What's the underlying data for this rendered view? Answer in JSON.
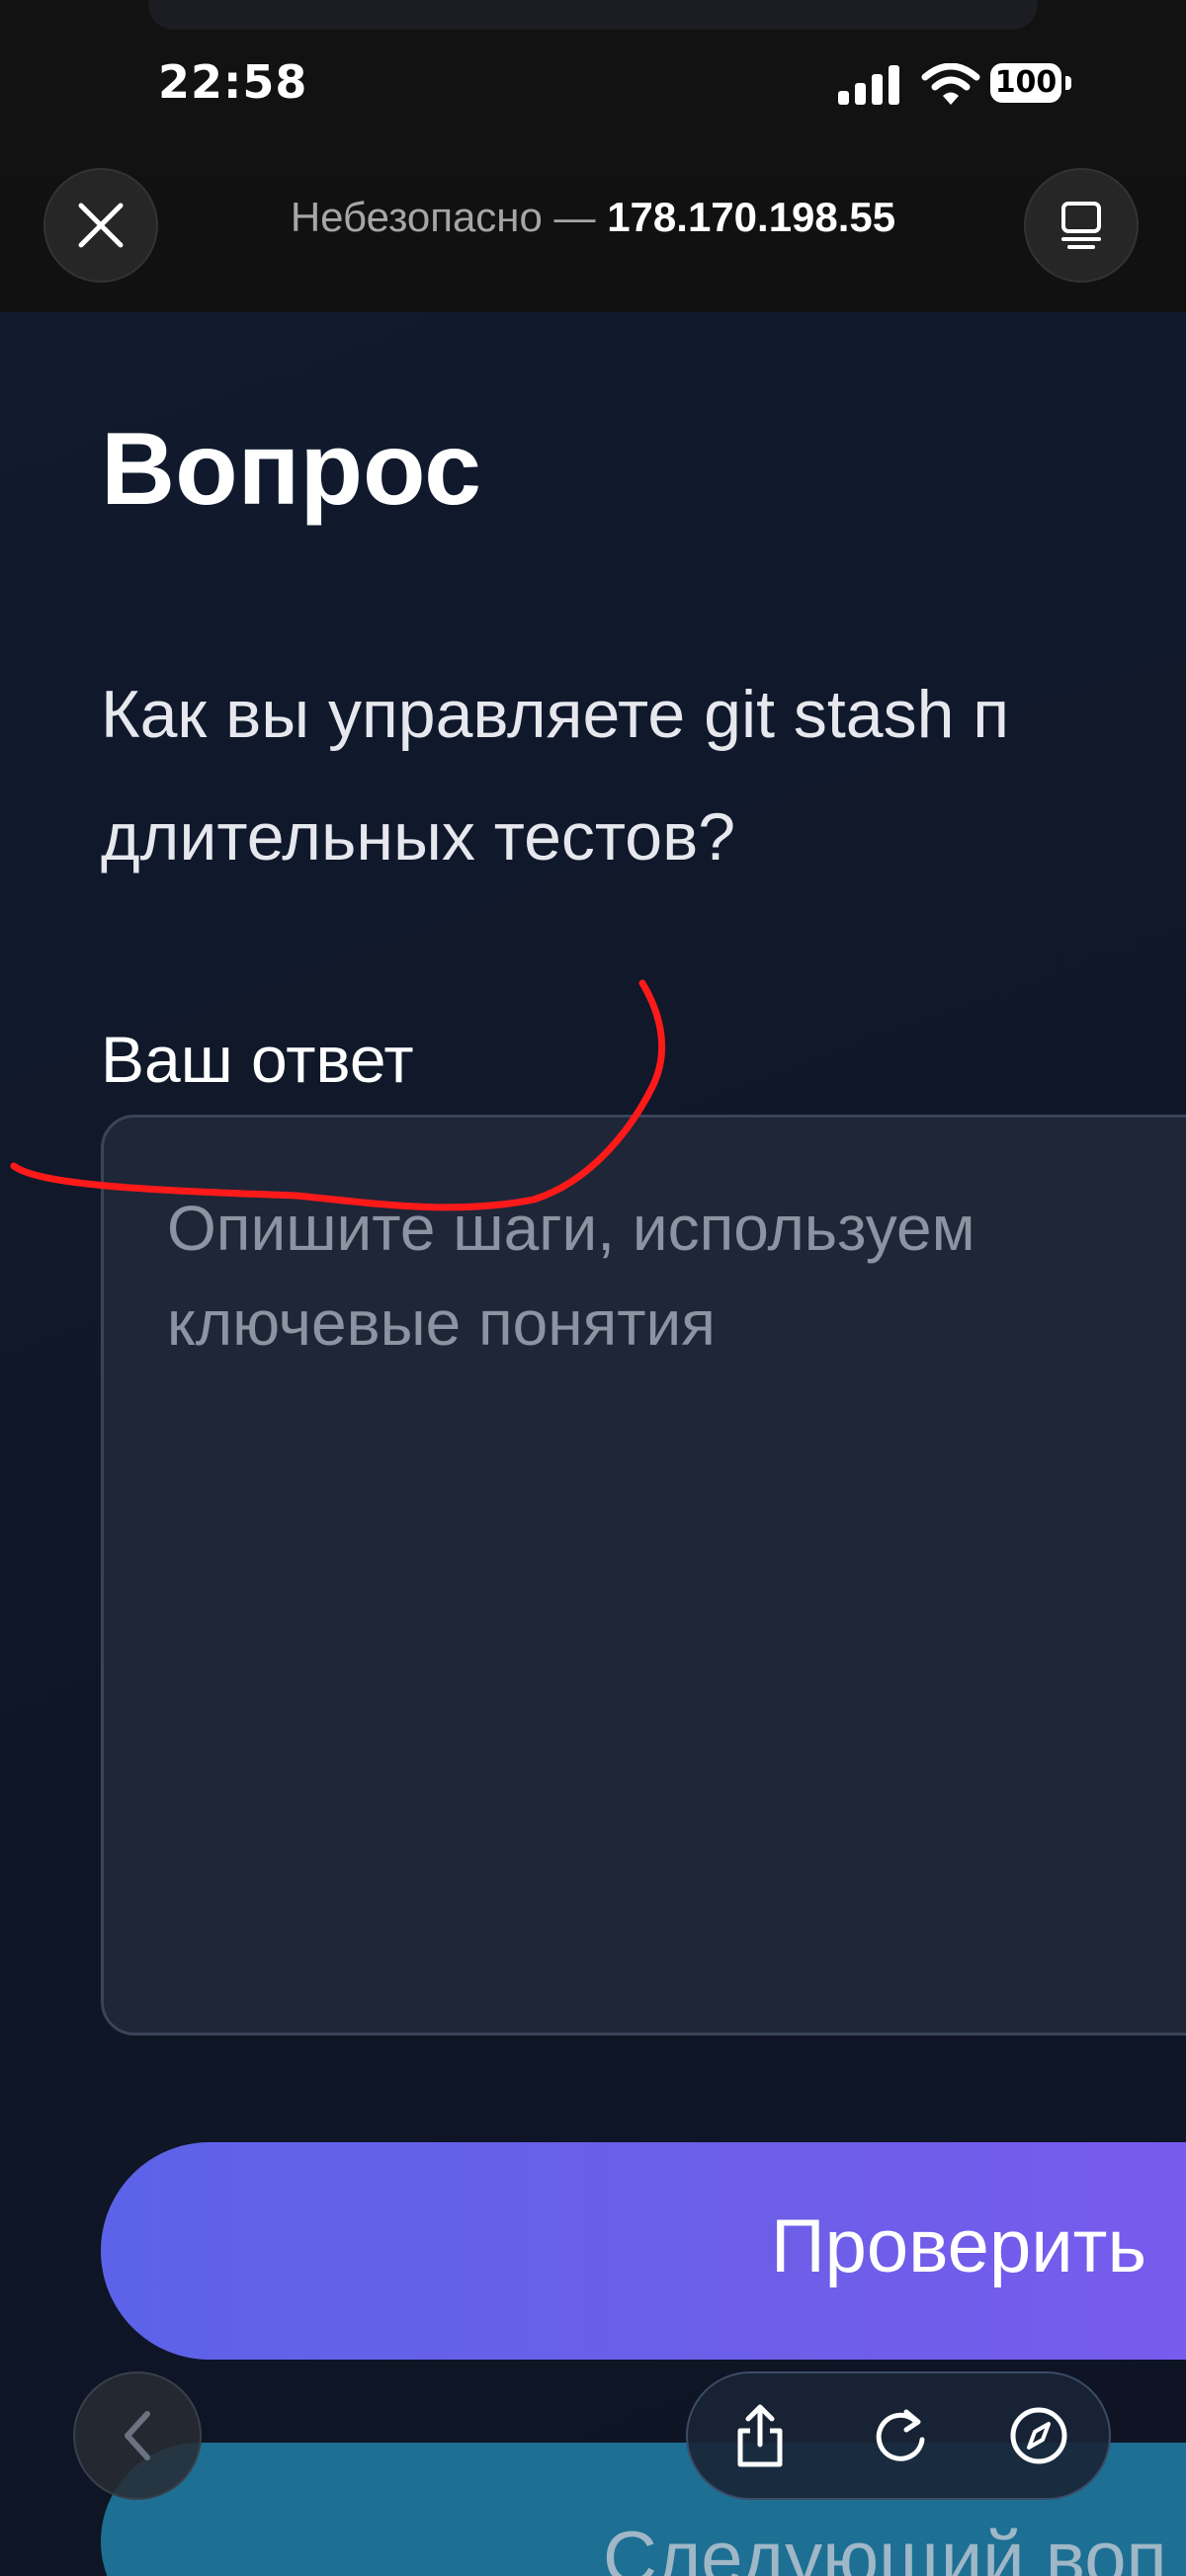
{
  "status_bar": {
    "time": "22:58",
    "battery": "100",
    "icons": [
      "signal-icon",
      "wifi-icon",
      "battery-icon"
    ]
  },
  "browser": {
    "url_prefix": "Небезопасно — ",
    "url_host": "178.170.198.55",
    "icons": [
      "close-icon",
      "tabs-icon",
      "back-arrow-icon",
      "share-icon",
      "reload-icon",
      "compass-icon"
    ]
  },
  "page": {
    "heading": "Вопрос",
    "question": "Как вы управляете git stash п\nдлительных тестов?",
    "answer_label": "Ваш ответ",
    "answer_placeholder": "Опишите шаги, используем ключевые понятия",
    "check_button": "Проверить",
    "next_button": "Следующий воп"
  },
  "colors": {
    "background": "#101729",
    "button_gradient_start": "#5c63e8",
    "button_gradient_end": "#7b5af0",
    "next_button": "#1d6f93",
    "annotation_stroke": "#ff1a1a"
  }
}
